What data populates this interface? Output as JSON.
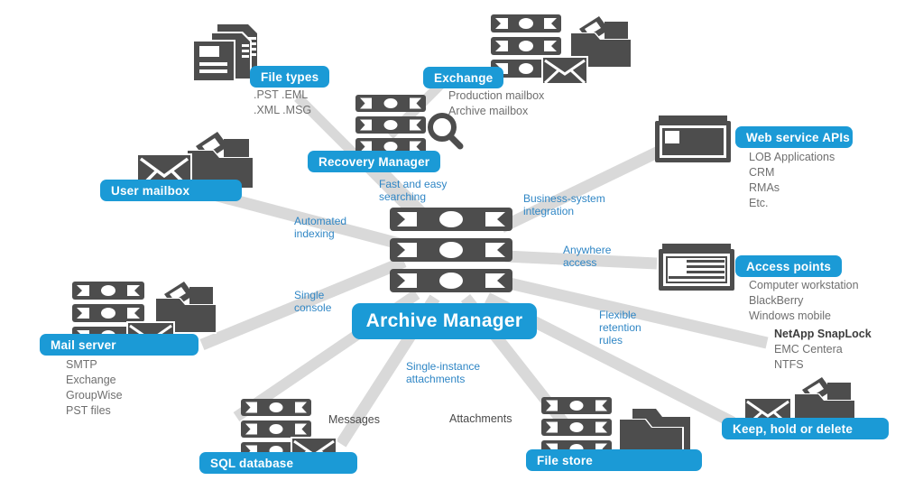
{
  "diagram": {
    "title": "Archive Manager architecture diagram",
    "accent_color": "#1b9ad6",
    "icon_color": "#4d4d4d",
    "connector_color": "#d9d9d9",
    "label_color": "#2f86c5"
  },
  "center": {
    "label": "Archive Manager",
    "icon": "server-stack-icon"
  },
  "nodes": [
    {
      "id": "file-types",
      "label": "File types",
      "icon": "documents-stack-icon",
      "sublist": [
        ".PST   .EML",
        ".XML   .MSG"
      ]
    },
    {
      "id": "recovery-manager",
      "label": "Recovery Manager",
      "icon": "server-stack-search-icon",
      "sublist": []
    },
    {
      "id": "exchange",
      "label": "Exchange",
      "icon": "server-stack-mail-folder-icon",
      "sublist": [
        "Production mailbox",
        "Archive mailbox"
      ]
    },
    {
      "id": "user-mailbox",
      "label": "User mailbox",
      "icon": "mail-folder-icon",
      "sublist": []
    },
    {
      "id": "mail-server",
      "label": "Mail server",
      "icon": "server-stack-mail-folder-icon",
      "sublist": [
        "SMTP",
        "Exchange",
        "GroupWise",
        "PST files"
      ]
    },
    {
      "id": "web-service-apis",
      "label": "Web service APIs",
      "icon": "browser-window-icon",
      "sublist": [
        "LOB Applications",
        "CRM",
        "RMAs",
        "Etc."
      ]
    },
    {
      "id": "access-points",
      "label": "Access points",
      "icon": "browser-window-icon",
      "sublist": [
        "Computer workstation",
        "BlackBerry",
        "Windows mobile"
      ]
    },
    {
      "id": "storage-targets",
      "label": "",
      "icon": "",
      "sublist": [
        "NetApp SnapLock",
        "EMC Centera",
        "NTFS"
      ],
      "bold_first": true
    },
    {
      "id": "keep-hold-delete",
      "label": "Keep, hold or delete",
      "icon": "mail-folder-icon",
      "sublist": []
    },
    {
      "id": "sql-database",
      "label": "SQL database",
      "icon": "server-stack-mail-icon",
      "sublist": []
    },
    {
      "id": "file-store",
      "label": "File store",
      "icon": "server-stack-documents-folder-icon",
      "sublist": []
    }
  ],
  "connector_labels": [
    {
      "id": "fast-and-easy-searching",
      "lines": [
        "Fast and easy",
        "searching"
      ]
    },
    {
      "id": "automated-indexing",
      "lines": [
        "Automated",
        "indexing"
      ]
    },
    {
      "id": "business-system-integration",
      "lines": [
        "Business-system",
        "integration"
      ]
    },
    {
      "id": "anywhere-access",
      "lines": [
        "Anywhere",
        "access"
      ]
    },
    {
      "id": "single-console",
      "lines": [
        "Single",
        "console"
      ]
    },
    {
      "id": "flexible-retention-rules",
      "lines": [
        "Flexible",
        "retention",
        "rules"
      ]
    },
    {
      "id": "single-instance-attachments",
      "lines": [
        "Single-instance",
        "attachments"
      ]
    }
  ],
  "plain_labels": [
    {
      "id": "messages",
      "text": "Messages"
    },
    {
      "id": "attachments",
      "text": "Attachments"
    }
  ]
}
